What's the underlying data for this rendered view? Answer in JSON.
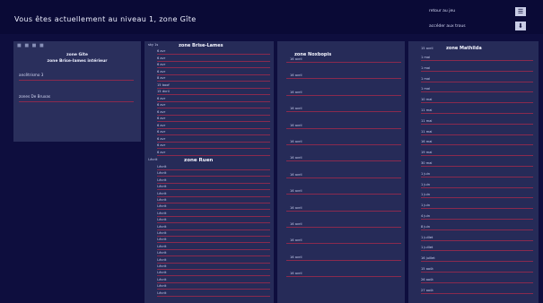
{
  "header": {
    "title": "Vous êtes actuellement au niveau 1, zone Gîte",
    "link_game": "retour au jeu",
    "link_holes": "accéder aux trous"
  },
  "sidebar": {
    "dots": "■ ■ ■ ■",
    "title1": "zone Gîte",
    "title2": "zone Brise-lames intérieur",
    "item1": "ancêtrismo 3",
    "item2": "zones De Bruxas"
  },
  "col1": {
    "prefix": "sky 1s",
    "title": "zone Brise-Lames",
    "items": [
      "6 avr",
      "6 avr",
      "6 avr",
      "6 avr",
      "8 avr",
      "15 boof",
      "15 dvrii",
      "6 avr",
      "6 avr",
      "6 avr",
      "6 avr",
      "6 avr",
      "6 avr",
      "6 avr",
      "6 avr",
      "6 avr"
    ],
    "mid_prefix": "l-écrit",
    "mid_title": "zone Ruen",
    "mid_items": [
      "l-écrit",
      "l-écrit",
      "l-écrit",
      "l-écrit",
      "l-écrit",
      "l-écrit",
      "l-écrit",
      "l-écrit",
      "l-écrit",
      "l-écrit",
      "l-écrit",
      "l-écrit",
      "l-écrit",
      "l-écrit",
      "l-écrit",
      "l-écrit",
      "l-écrit",
      "l-écrit",
      "l-écrit",
      "l-écrit"
    ]
  },
  "col2": {
    "title": "zone Noxbopis",
    "items": [
      "16 avril",
      "16 avril",
      "16 avril",
      "16 avril",
      "16 avril",
      "16 avril",
      "16 avril",
      "16 avril",
      "16 avril",
      "16 avril",
      "16 avril",
      "16 avril",
      "16 avril",
      "16 avril"
    ]
  },
  "col3": {
    "prefix": "15 avril",
    "title": "zone Mathilda",
    "items": [
      "1 mai",
      "1 mai",
      "1 mai",
      "1 mai",
      "10 mai",
      "11 mai",
      "11 mai",
      "11 mai",
      "16 mai",
      "19 mai",
      "30 mai",
      "1 juin",
      "1 juin",
      "1 juin",
      "1 juin",
      "4 juin",
      "8 juin",
      "1 juillet",
      "1 juillet",
      "16 juillet",
      "15 août",
      "26 août",
      "27 août"
    ]
  }
}
